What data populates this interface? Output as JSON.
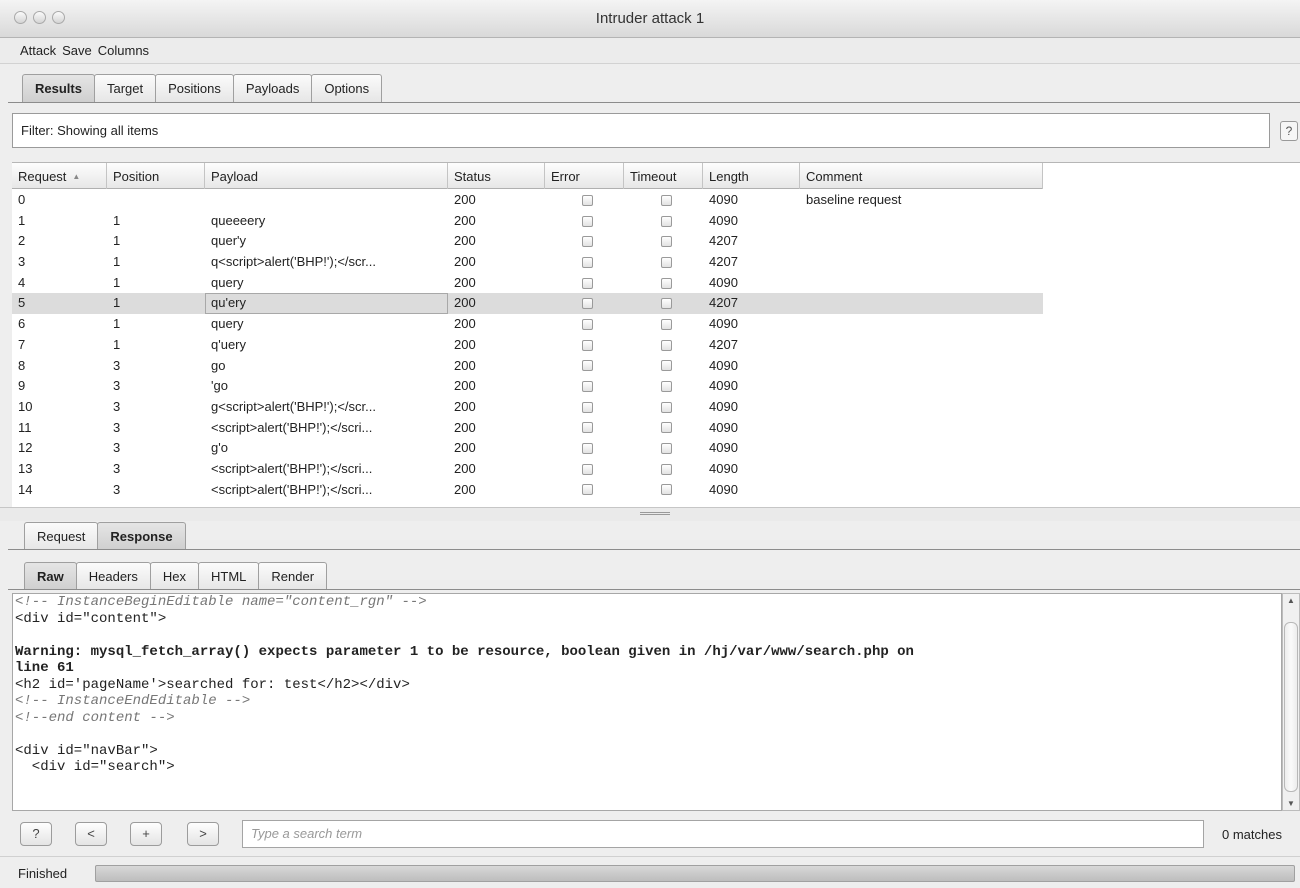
{
  "window": {
    "title": "Intruder attack 1"
  },
  "menu": [
    "Attack",
    "Save",
    "Columns"
  ],
  "main_tabs": [
    "Results",
    "Target",
    "Positions",
    "Payloads",
    "Options"
  ],
  "filter": {
    "label": "Filter: Showing all items",
    "help": "?"
  },
  "table": {
    "columns": [
      "Request",
      "Position",
      "Payload",
      "Status",
      "Error",
      "Timeout",
      "Length",
      "Comment"
    ],
    "rows": [
      {
        "request": "0",
        "position": "",
        "payload": "",
        "status": "200",
        "length": "4090",
        "comment": "baseline request"
      },
      {
        "request": "1",
        "position": "1",
        "payload": "queeeery",
        "status": "200",
        "length": "4090",
        "comment": ""
      },
      {
        "request": "2",
        "position": "1",
        "payload": "quer'y",
        "status": "200",
        "length": "4207",
        "comment": ""
      },
      {
        "request": "3",
        "position": "1",
        "payload": "q<script>alert('BHP!');</scr...",
        "status": "200",
        "length": "4207",
        "comment": ""
      },
      {
        "request": "4",
        "position": "1",
        "payload": "query",
        "status": "200",
        "length": "4090",
        "comment": ""
      },
      {
        "request": "5",
        "position": "1",
        "payload": "qu'ery",
        "status": "200",
        "length": "4207",
        "comment": ""
      },
      {
        "request": "6",
        "position": "1",
        "payload": "query",
        "status": "200",
        "length": "4090",
        "comment": ""
      },
      {
        "request": "7",
        "position": "1",
        "payload": "q'uery",
        "status": "200",
        "length": "4207",
        "comment": ""
      },
      {
        "request": "8",
        "position": "3",
        "payload": "go",
        "status": "200",
        "length": "4090",
        "comment": ""
      },
      {
        "request": "9",
        "position": "3",
        "payload": "'go",
        "status": "200",
        "length": "4090",
        "comment": ""
      },
      {
        "request": "10",
        "position": "3",
        "payload": "g<script>alert('BHP!');</scr...",
        "status": "200",
        "length": "4090",
        "comment": ""
      },
      {
        "request": "11",
        "position": "3",
        "payload": "<script>alert('BHP!');</scri...",
        "status": "200",
        "length": "4090",
        "comment": ""
      },
      {
        "request": "12",
        "position": "3",
        "payload": "g'o",
        "status": "200",
        "length": "4090",
        "comment": ""
      },
      {
        "request": "13",
        "position": "3",
        "payload": "<script>alert('BHP!');</scri...",
        "status": "200",
        "length": "4090",
        "comment": ""
      },
      {
        "request": "14",
        "position": "3",
        "payload": "<script>alert('BHP!');</scri...",
        "status": "200",
        "length": "4090",
        "comment": ""
      }
    ],
    "selected_request": "5"
  },
  "rr_tabs": [
    "Request",
    "Response"
  ],
  "view_tabs": [
    "Raw",
    "Headers",
    "Hex",
    "HTML",
    "Render"
  ],
  "response_lines": [
    {
      "text": "<!-- InstanceBeginEditable name=\"content_rgn\" -->",
      "style": "comment"
    },
    {
      "text": "<div id=\"content\">",
      "style": "normal"
    },
    {
      "text": "",
      "style": "normal"
    },
    {
      "text": "Warning: mysql_fetch_array() expects parameter 1 to be resource, boolean given in /hj/var/www/search.php on",
      "style": "bold"
    },
    {
      "text": "line 61",
      "style": "bold"
    },
    {
      "text": "<h2 id='pageName'>searched for: test</h2></div>",
      "style": "normal"
    },
    {
      "text": "<!-- InstanceEndEditable -->",
      "style": "comment"
    },
    {
      "text": "<!--end content -->",
      "style": "comment"
    },
    {
      "text": "",
      "style": "normal"
    },
    {
      "text": "<div id=\"navBar\">",
      "style": "normal"
    },
    {
      "text": "  <div id=\"search\">",
      "style": "normal"
    }
  ],
  "search": {
    "buttons": [
      "?",
      "<",
      "+",
      ">"
    ],
    "placeholder": "Type a search term",
    "matches": "0 matches"
  },
  "status": {
    "text": "Finished"
  }
}
